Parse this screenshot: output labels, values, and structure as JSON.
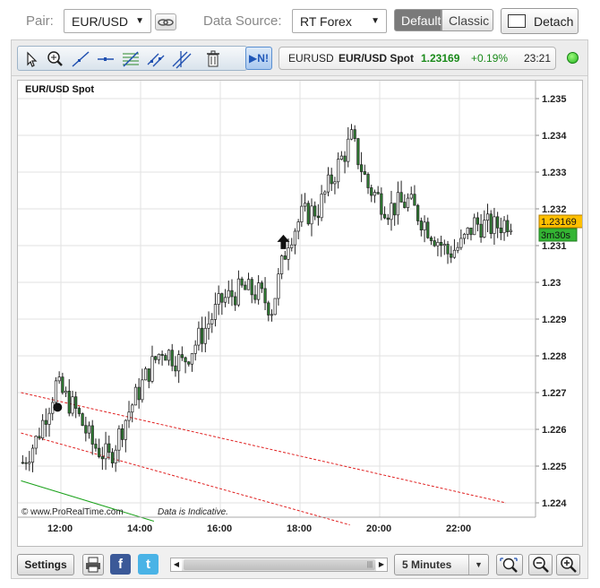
{
  "top": {
    "pair_label": "Pair:",
    "pair_value": "EUR/USD",
    "source_label": "Data Source:",
    "source_value": "RT Forex",
    "default_label": "Default",
    "classic_label": "Classic",
    "detach_label": "Detach"
  },
  "ticker": {
    "symbol": "EURUSD",
    "name": "EUR/USD Spot",
    "price": "1.23169",
    "change": "+0.19%",
    "time": "23:21"
  },
  "toolbar": {
    "next_label": "▶N!"
  },
  "colors": {
    "accent_green": "#1a8a1a",
    "price_tag": "#ffc000",
    "timer_tag": "#33b533",
    "trend_red": "#e02020",
    "trend_green": "#1aa11a"
  },
  "chart_data": {
    "type": "candlestick",
    "title": "EUR/USD Spot",
    "watermark": "© www.ProRealTime.com",
    "disclaimer": "Data is Indicative.",
    "x_ticks": [
      "12:00",
      "14:00",
      "16:00",
      "18:00",
      "20:00",
      "22:00"
    ],
    "y_ticks": [
      "1.235",
      "1.234",
      "1.233",
      "1.232",
      "1.231",
      "1.23",
      "1.229",
      "1.228",
      "1.227",
      "1.226",
      "1.225",
      "1.224"
    ],
    "ylim": [
      1.2236,
      1.2355
    ],
    "price_label": "1.23169",
    "timer_label": "3m30s",
    "grid": true,
    "trend_lines": [
      {
        "color": "red",
        "style": "dashed",
        "from": [
          "11:00",
          1.227
        ],
        "to": [
          "23:10",
          1.224
        ]
      },
      {
        "color": "red",
        "style": "dashed",
        "from": [
          "11:00",
          1.2259
        ],
        "to": [
          "19:15",
          1.2234
        ]
      },
      {
        "color": "green",
        "style": "solid",
        "from": [
          "11:00",
          1.2246
        ],
        "to": [
          "14:20",
          1.2235
        ]
      }
    ],
    "markers": [
      {
        "type": "up-arrow",
        "time": "17:35",
        "price": 1.2311
      },
      {
        "type": "round",
        "time": "11:55",
        "price": 1.2266
      }
    ],
    "keypoints": [
      [
        "11:00",
        1.2251
      ],
      [
        "11:20",
        1.2257
      ],
      [
        "11:50",
        1.2272
      ],
      [
        "12:20",
        1.2265
      ],
      [
        "12:45",
        1.2256
      ],
      [
        "13:10",
        1.2252
      ],
      [
        "13:40",
        1.2265
      ],
      [
        "14:10",
        1.2276
      ],
      [
        "14:30",
        1.2282
      ],
      [
        "15:00",
        1.2278
      ],
      [
        "15:30",
        1.2286
      ],
      [
        "16:00",
        1.2295
      ],
      [
        "16:30",
        1.2298
      ],
      [
        "16:55",
        1.2297
      ],
      [
        "17:15",
        1.2293
      ],
      [
        "17:40",
        1.2312
      ],
      [
        "18:00",
        1.2318
      ],
      [
        "18:25",
        1.232
      ],
      [
        "18:50",
        1.233
      ],
      [
        "19:15",
        1.2339
      ],
      [
        "19:40",
        1.2326
      ],
      [
        "20:10",
        1.232
      ],
      [
        "20:40",
        1.2322
      ],
      [
        "21:10",
        1.2315
      ],
      [
        "21:40",
        1.2308
      ],
      [
        "22:00",
        1.231
      ],
      [
        "22:20",
        1.2316
      ],
      [
        "22:50",
        1.2315
      ],
      [
        "23:15",
        1.2317
      ]
    ]
  },
  "bottom": {
    "settings_label": "Settings",
    "timeframe_value": "5 Minutes",
    "facebook_glyph": "f",
    "twitter_glyph": "t"
  }
}
